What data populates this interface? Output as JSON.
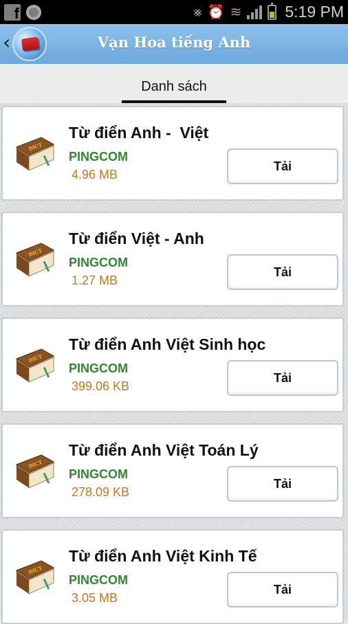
{
  "status_bar": {
    "time": "5:19 PM",
    "icons": [
      "facebook-icon",
      "circle-icon",
      "mute-icon",
      "alarm-icon",
      "wifi-icon",
      "signal-icon",
      "battery-icon"
    ]
  },
  "header": {
    "title": "Vạn Hoa tiếng Anh",
    "back_glyph": "‹"
  },
  "tabs": [
    {
      "label": "Danh sách",
      "active": true
    }
  ],
  "items": [
    {
      "title": "Từ điển Anh -  Việt",
      "publisher": "PINGCOM",
      "size": "4.96 MB",
      "button": "Tải"
    },
    {
      "title": "Từ điển Việt - Anh",
      "publisher": "PINGCOM",
      "size": "1.27 MB",
      "button": "Tải"
    },
    {
      "title": "Từ điển Anh Việt Sinh học",
      "publisher": "PINGCOM",
      "size": "399.06 KB",
      "button": "Tải"
    },
    {
      "title": "Từ điển Anh Việt Toán Lý",
      "publisher": "PINGCOM",
      "size": "278.09 KB",
      "button": "Tải"
    },
    {
      "title": "Từ điển Anh Việt Kinh Tế",
      "publisher": "PINGCOM",
      "size": "3.05 MB",
      "button": "Tải"
    }
  ],
  "colors": {
    "header": "#7ab4e4",
    "publisher": "#2c8a2c",
    "size": "#c9781c",
    "card_border": "#c2cde0"
  }
}
